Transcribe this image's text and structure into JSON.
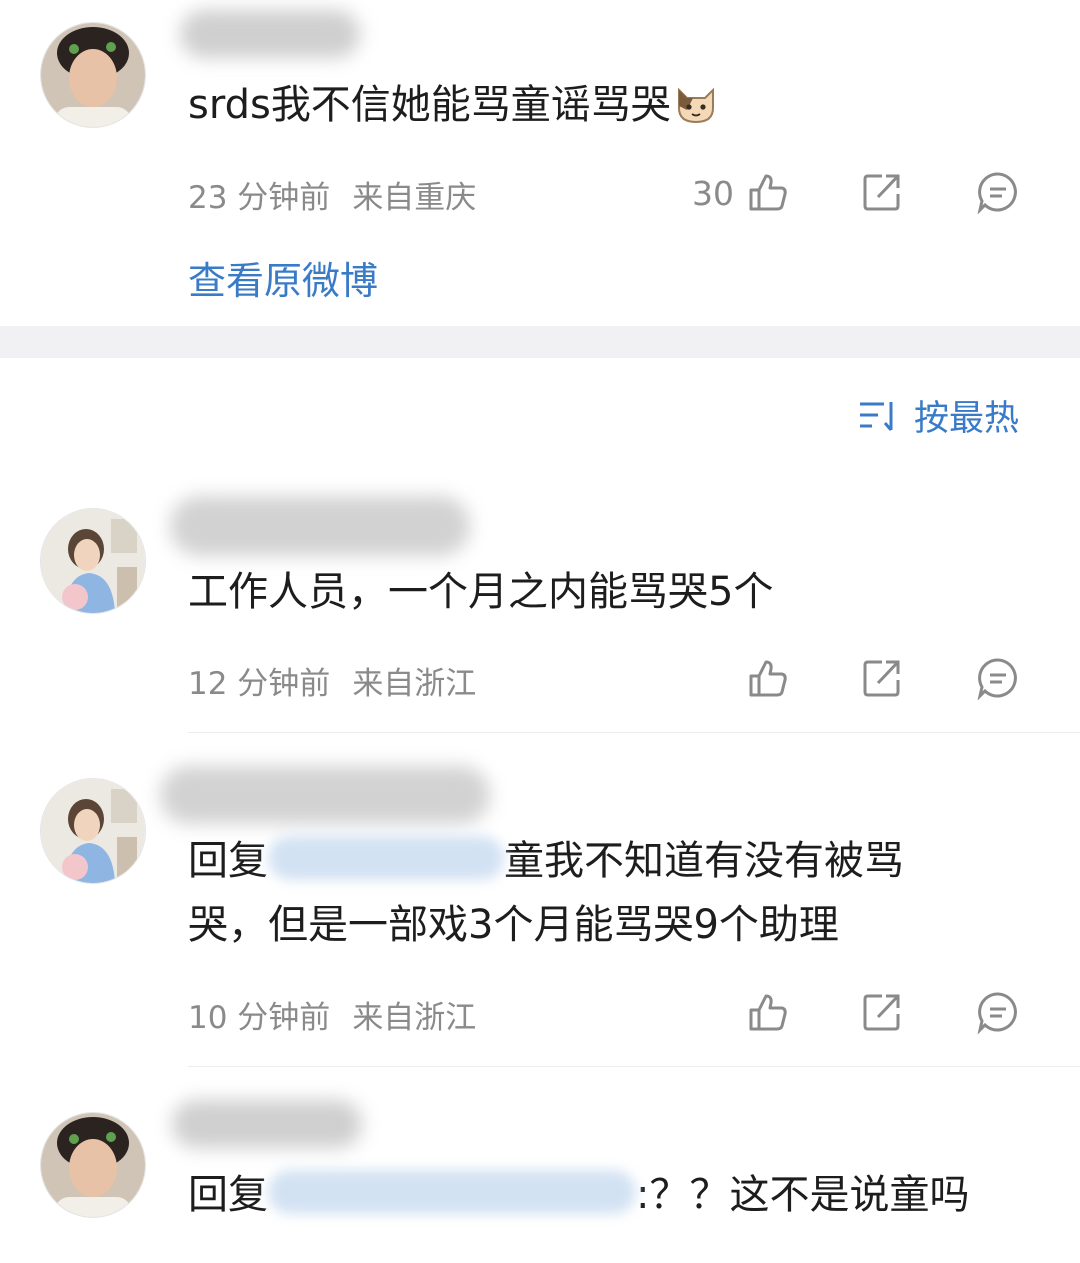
{
  "top_comment": {
    "content": "srds我不信她能骂童谣骂哭",
    "time": "23 分钟前",
    "location": "来自重庆",
    "like_count": "30",
    "view_original": "查看原微博"
  },
  "sort": {
    "label": "按最热"
  },
  "replies": [
    {
      "content": "工作人员，一个月之内能骂哭5个",
      "time": "12 分钟前",
      "location": "来自浙江"
    },
    {
      "prefix": "回复",
      "content_line1": "童我不知道有没有被骂",
      "content_line2": "哭，但是一部戏3个月能骂哭9个助理",
      "time": "10 分钟前",
      "location": "来自浙江"
    },
    {
      "prefix": "回复",
      "content": ":？？这不是说童吗"
    }
  ],
  "icons": [
    "like-icon",
    "share-icon",
    "comment-icon",
    "sort-icon",
    "cat-emoji-icon"
  ],
  "colors": {
    "link": "#3a7bc8",
    "meta": "#8a8a8a",
    "separator": "#f1f1f3"
  }
}
